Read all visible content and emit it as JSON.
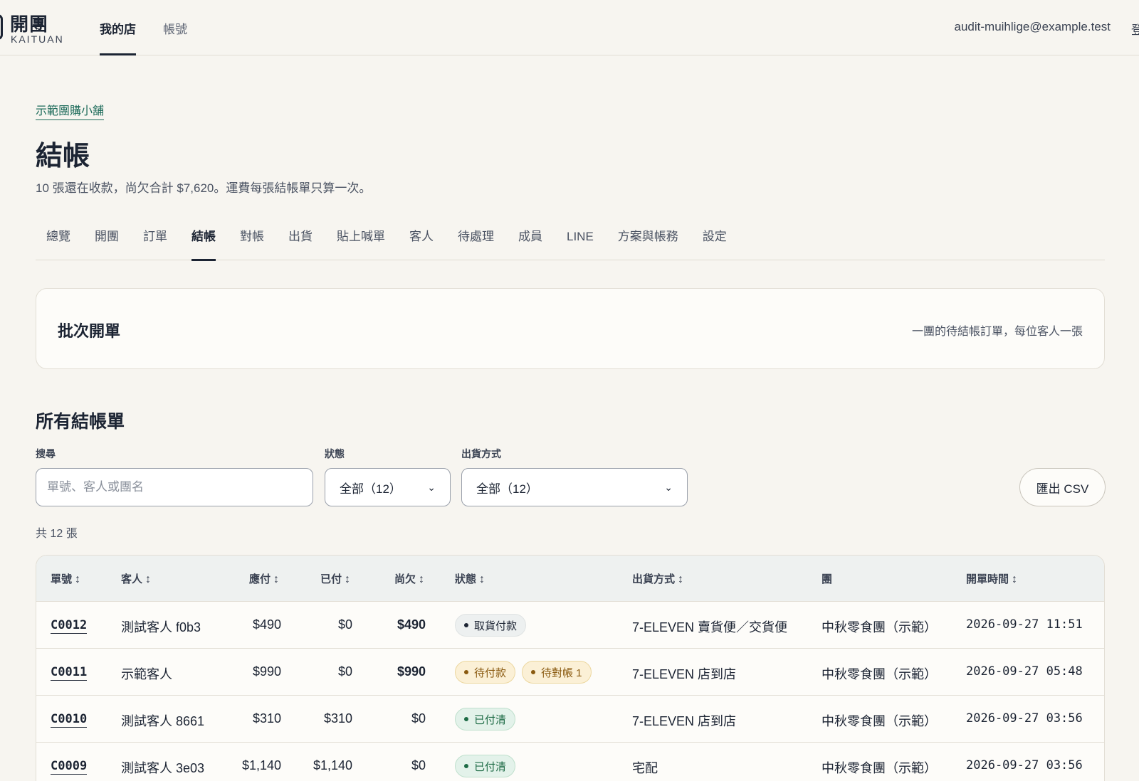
{
  "header": {
    "logo_cn": "開團",
    "logo_en": "KAITUAN",
    "nav": [
      {
        "label": "我的店",
        "active": true
      },
      {
        "label": "帳號",
        "active": false
      }
    ],
    "user_email": "audit-muihlige@example.test",
    "user_extra": "登"
  },
  "page": {
    "shop_link": "示範團購小舖",
    "title": "結帳",
    "summary": "10 張還在收款，尚欠合計 $7,620。運費每張結帳單只算一次。"
  },
  "tabs": [
    {
      "label": "總覽",
      "active": false
    },
    {
      "label": "開團",
      "active": false
    },
    {
      "label": "訂單",
      "active": false
    },
    {
      "label": "結帳",
      "active": true
    },
    {
      "label": "對帳",
      "active": false
    },
    {
      "label": "出貨",
      "active": false
    },
    {
      "label": "貼上喊單",
      "active": false
    },
    {
      "label": "客人",
      "active": false
    },
    {
      "label": "待處理",
      "active": false
    },
    {
      "label": "成員",
      "active": false
    },
    {
      "label": "LINE",
      "active": false
    },
    {
      "label": "方案與帳務",
      "active": false
    },
    {
      "label": "設定",
      "active": false
    }
  ],
  "batch": {
    "title": "批次開單",
    "hint": "一團的待結帳訂單，每位客人一張"
  },
  "bills": {
    "title": "所有結帳單",
    "search_label": "搜尋",
    "search_placeholder": "單號、客人或團名",
    "status_label": "狀態",
    "status_value": "全部（12）",
    "shipping_label": "出貨方式",
    "shipping_value": "全部（12）",
    "csv_label": "匯出 CSV",
    "count_text": "共 12 張"
  },
  "table": {
    "headers": {
      "code": "單號",
      "customer": "客人",
      "due": "應付",
      "paid": "已付",
      "owed": "尚欠",
      "status": "狀態",
      "shipping": "出貨方式",
      "group": "團",
      "opened": "開單時間"
    },
    "sort_glyph": "↕",
    "badge_dot": "•",
    "rows": [
      {
        "code": "C0012",
        "customer": "測試客人 f0b3",
        "due": "$490",
        "paid": "$0",
        "owed": "$490",
        "badges": [
          {
            "label": "取貨付款",
            "tone": "gray"
          }
        ],
        "shipping": "7-ELEVEN 賣貨便／交貨便",
        "group": "中秋零食團（示範）",
        "opened": "2026-09-27 11:51"
      },
      {
        "code": "C0011",
        "customer": "示範客人",
        "due": "$990",
        "paid": "$0",
        "owed": "$990",
        "badges": [
          {
            "label": "待付款",
            "tone": "amber"
          },
          {
            "label": "待對帳 1",
            "tone": "amber"
          }
        ],
        "shipping": "7-ELEVEN 店到店",
        "group": "中秋零食團（示範）",
        "opened": "2026-09-27 05:48"
      },
      {
        "code": "C0010",
        "customer": "測試客人 8661",
        "due": "$310",
        "paid": "$310",
        "owed": "$0",
        "badges": [
          {
            "label": "已付清",
            "tone": "green"
          }
        ],
        "shipping": "7-ELEVEN 店到店",
        "group": "中秋零食團（示範）",
        "opened": "2026-09-27 03:56"
      },
      {
        "code": "C0009",
        "customer": "測試客人 3e03",
        "due": "$1,140",
        "paid": "$1,140",
        "owed": "$0",
        "badges": [
          {
            "label": "已付清",
            "tone": "green"
          }
        ],
        "shipping": "宅配",
        "group": "中秋零食團（示範）",
        "opened": "2026-09-27 03:56"
      }
    ]
  }
}
